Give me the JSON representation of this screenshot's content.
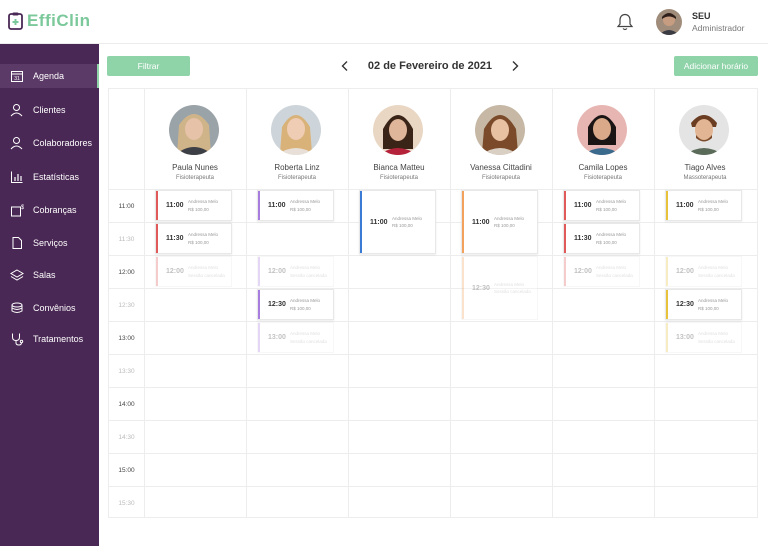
{
  "app": {
    "logo_text": "EffiClin"
  },
  "user": {
    "name": "SEU",
    "role": "Administrador"
  },
  "sidebar": {
    "items": [
      {
        "label": "Agenda",
        "icon": "calendar-icon",
        "active": true
      },
      {
        "label": "Clientes",
        "icon": "user-icon"
      },
      {
        "label": "Colaboradores",
        "icon": "user-icon"
      },
      {
        "label": "Estatísticas",
        "icon": "chart-icon"
      },
      {
        "label": "Cobranças",
        "icon": "money-icon"
      },
      {
        "label": "Serviços",
        "icon": "file-icon"
      },
      {
        "label": "Salas",
        "icon": "layers-icon"
      },
      {
        "label": "Convênios",
        "icon": "coins-icon"
      },
      {
        "label": "Tratamentos",
        "icon": "stethoscope-icon"
      }
    ]
  },
  "toolbar": {
    "filter_label": "Filtrar",
    "date": "02 de Fevereiro de 2021",
    "add_label": "Adicionar horário"
  },
  "schedule": {
    "times": [
      "11:00",
      "11:30",
      "12:00",
      "12:30",
      "13:00",
      "13:30",
      "14:00",
      "14:30",
      "15:00",
      "15:30"
    ],
    "professionals": [
      {
        "name": "Paula Nunes",
        "role": "Fisioterapeuta"
      },
      {
        "name": "Roberta Linz",
        "role": "Fisioterapeuta"
      },
      {
        "name": "Bianca Matteu",
        "role": "Fisioterapeuta"
      },
      {
        "name": "Vanessa Cittadini",
        "role": "Fisioterapeuta"
      },
      {
        "name": "Camila Lopes",
        "role": "Fisioterapeuta"
      },
      {
        "name": "Tiago Alves",
        "role": "Massoterapeuta"
      }
    ],
    "appointments": [
      {
        "col": 0,
        "slot": 0,
        "span": 1,
        "time": "11:00",
        "client": "Andressa Melo",
        "price": "R$ 100,00",
        "color": "#e05a5a",
        "faded": false
      },
      {
        "col": 0,
        "slot": 1,
        "span": 1,
        "time": "11:30",
        "client": "Andressa Melo",
        "price": "R$ 100,00",
        "color": "#e05a5a",
        "faded": false
      },
      {
        "col": 0,
        "slot": 2,
        "span": 1,
        "time": "12:00",
        "client": "Andressa Melo",
        "price": "Sessão cancelada",
        "color": "#e05a5a",
        "faded": true
      },
      {
        "col": 1,
        "slot": 0,
        "span": 1,
        "time": "11:00",
        "client": "Andressa Melo",
        "price": "R$ 100,00",
        "color": "#a77de0",
        "faded": false
      },
      {
        "col": 1,
        "slot": 2,
        "span": 1,
        "time": "12:00",
        "client": "Andressa Melo",
        "price": "Sessão cancelada",
        "color": "#a77de0",
        "faded": true
      },
      {
        "col": 1,
        "slot": 3,
        "span": 1,
        "time": "12:30",
        "client": "Andressa Melo",
        "price": "R$ 100,00",
        "color": "#a77de0",
        "faded": false
      },
      {
        "col": 1,
        "slot": 4,
        "span": 1,
        "time": "13:00",
        "client": "Andressa Melo",
        "price": "Sessão cancelada",
        "color": "#a77de0",
        "faded": true
      },
      {
        "col": 2,
        "slot": 0,
        "span": 2,
        "time": "11:00",
        "client": "Andressa Melo",
        "price": "R$ 100,00",
        "color": "#3a7bd5",
        "faded": false
      },
      {
        "col": 3,
        "slot": 0,
        "span": 2,
        "time": "11:00",
        "client": "Andressa Melo",
        "price": "R$ 100,00",
        "color": "#f2a25c",
        "faded": false
      },
      {
        "col": 3,
        "slot": 2,
        "span": 2,
        "time": "12:30",
        "client": "Andressa Melo",
        "price": "Sessão cancelada",
        "color": "#f2a25c",
        "faded": true
      },
      {
        "col": 4,
        "slot": 0,
        "span": 1,
        "time": "11:00",
        "client": "Andressa Melo",
        "price": "R$ 100,00",
        "color": "#e05a5a",
        "faded": false
      },
      {
        "col": 4,
        "slot": 1,
        "span": 1,
        "time": "11:30",
        "client": "Andressa Melo",
        "price": "R$ 100,00",
        "color": "#e05a5a",
        "faded": false
      },
      {
        "col": 4,
        "slot": 2,
        "span": 1,
        "time": "12:00",
        "client": "Andressa Melo",
        "price": "Sessão cancelada",
        "color": "#e05a5a",
        "faded": true
      },
      {
        "col": 5,
        "slot": 0,
        "span": 1,
        "time": "11:00",
        "client": "Andressa Melo",
        "price": "R$ 100,00",
        "color": "#e8c23a",
        "faded": false
      },
      {
        "col": 5,
        "slot": 2,
        "span": 1,
        "time": "12:00",
        "client": "Andressa Melo",
        "price": "Sessão cancelada",
        "color": "#e8c23a",
        "faded": true
      },
      {
        "col": 5,
        "slot": 3,
        "span": 1,
        "time": "12:30",
        "client": "Andressa Melo",
        "price": "R$ 100,00",
        "color": "#e8c23a",
        "faded": false
      },
      {
        "col": 5,
        "slot": 4,
        "span": 1,
        "time": "13:00",
        "client": "Andressa Melo",
        "price": "Sessão cancelada",
        "color": "#e8c23a",
        "faded": true
      }
    ]
  }
}
